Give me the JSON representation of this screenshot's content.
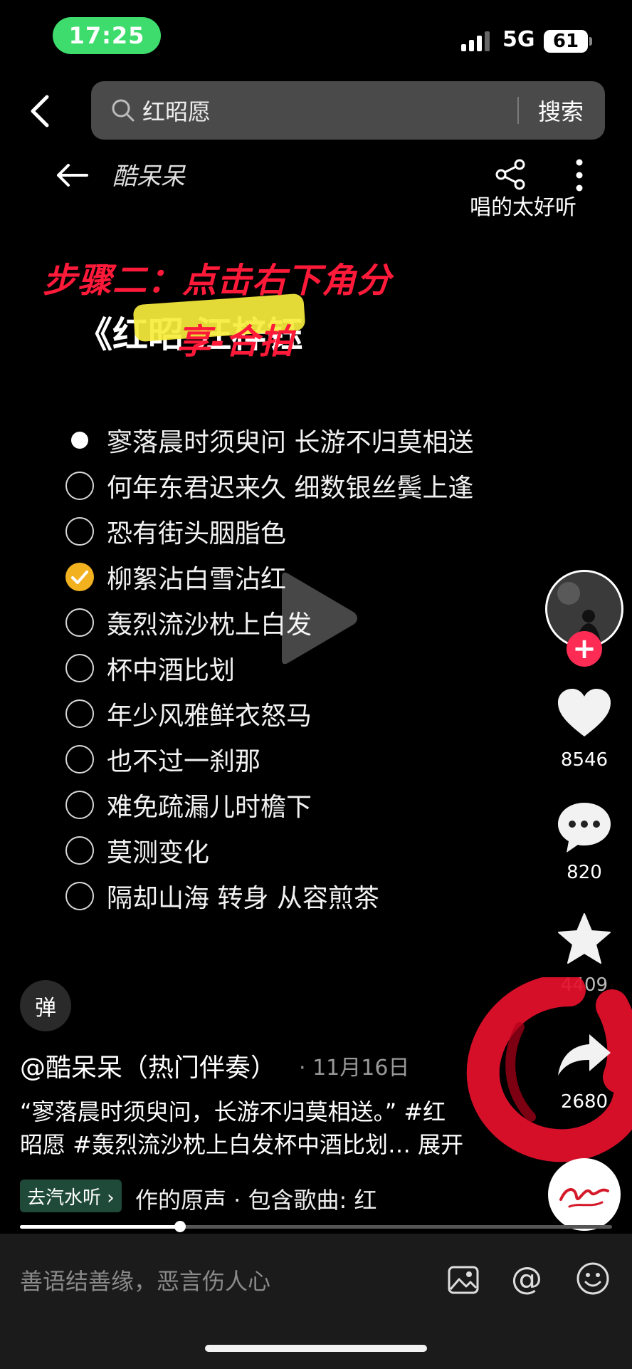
{
  "status": {
    "time": "17:25",
    "network": "5G",
    "battery": "61"
  },
  "search": {
    "query": "红昭愿",
    "button": "搜索"
  },
  "video": {
    "author": "酷呆呆",
    "top_caption": "唱的太好听",
    "overlay_line1": "步骤二：点击右下角分",
    "overlay_line2": "享-合拍",
    "title_partial": "《红昭        汪梓钰"
  },
  "lyrics": [
    {
      "text": "寥落晨时须臾问 长游不归莫相送",
      "state": "filled"
    },
    {
      "text": "何年东君迟来久 细数银丝鬓上逢",
      "state": "empty"
    },
    {
      "text": "恐有街头胭脂色",
      "state": "empty"
    },
    {
      "text": "柳絮沾白雪沾红",
      "state": "checked"
    },
    {
      "text": "轰烈流沙枕上白发",
      "state": "empty"
    },
    {
      "text": "杯中酒比划",
      "state": "empty"
    },
    {
      "text": "年少风雅鲜衣怒马",
      "state": "empty"
    },
    {
      "text": "也不过一刹那",
      "state": "empty"
    },
    {
      "text": "难免疏漏儿时檐下",
      "state": "empty"
    },
    {
      "text": "莫测变化",
      "state": "empty"
    },
    {
      "text": "隔却山海 转身 从容煎茶",
      "state": "empty"
    }
  ],
  "rail": {
    "likes": "8546",
    "comments": "820",
    "favorites": "4409",
    "shares": "2680",
    "follow": "+"
  },
  "danmu": "弹",
  "info": {
    "uploader": "@酷呆呆（热门伴奏）",
    "date": "· 11月16日",
    "desc_line1": "“寥落晨时须臾问，长游不归莫相送。” #红",
    "desc_line2": "昭愿 #轰烈流沙枕上白发杯中酒比划… 展开",
    "music_tag": "去汽水听 ›",
    "music_line": "作的原声 · 包含歌曲: 红",
    "progress": 0.27
  },
  "comment": {
    "placeholder": "善语结善缘，恶言伤人心",
    "at": "@"
  },
  "colors": {
    "accent_red": "#fe2c55",
    "status_green": "#3ddc6c",
    "check_yellow": "#f2b21f",
    "overlay_red": "#ff1a3a"
  }
}
